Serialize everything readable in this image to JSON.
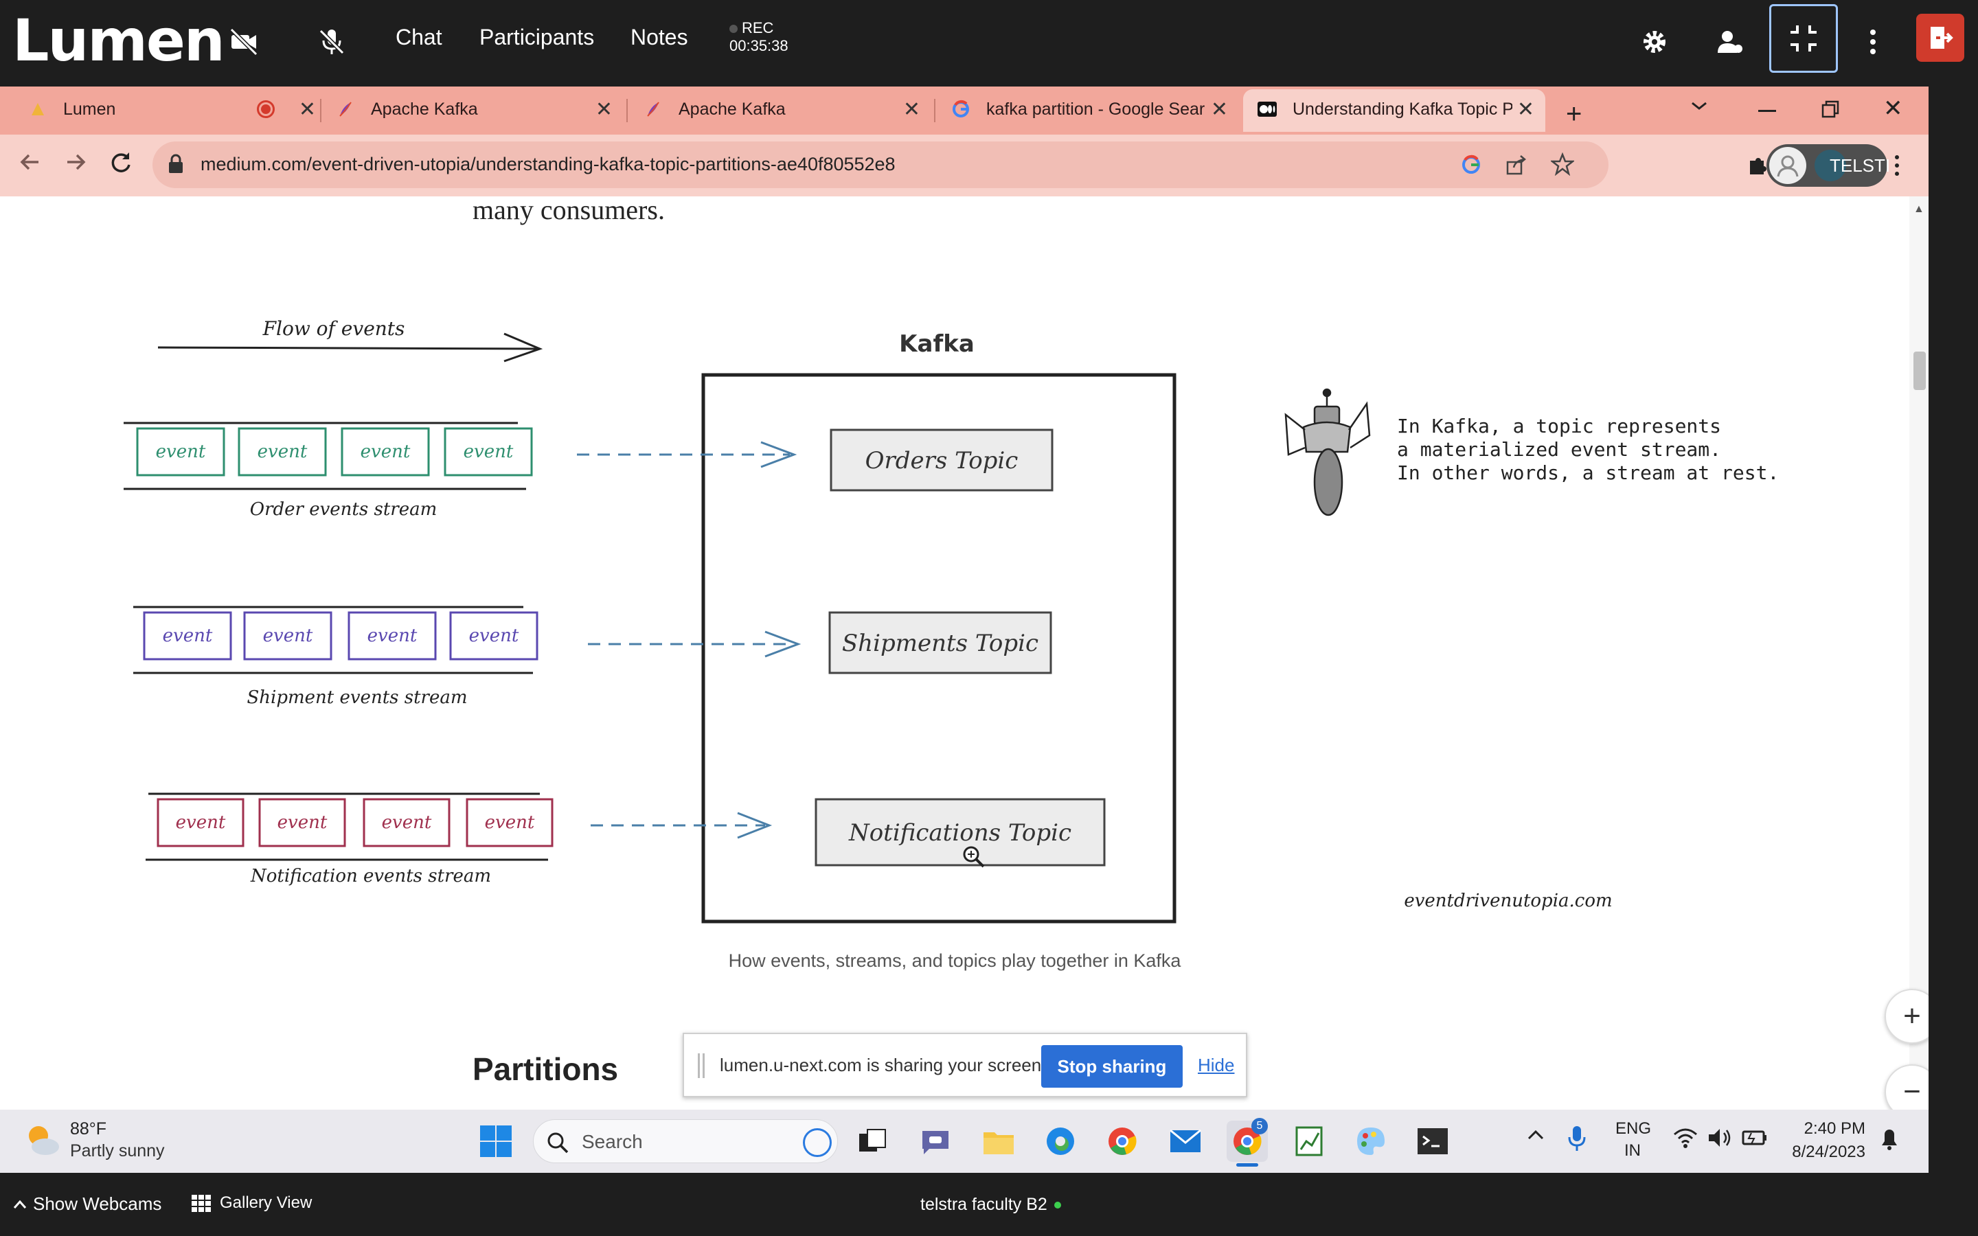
{
  "lumen": {
    "logo": "Lumen",
    "nav": {
      "chat": "Chat",
      "participants": "Participants",
      "notes": "Notes"
    },
    "rec_label": "REC",
    "rec_time": "00:35:38",
    "icons": [
      "video-off-icon",
      "mic-off-icon",
      "gear-icon",
      "person-icon",
      "minimize-icon",
      "more-icon",
      "leave-icon"
    ]
  },
  "browser": {
    "tabs": [
      {
        "title": "Lumen",
        "icon": "lumen-icon"
      },
      {
        "title": "Apache Kafka",
        "icon": "kafka-icon"
      },
      {
        "title": "Apache Kafka",
        "icon": "kafka-icon"
      },
      {
        "title": "kafka partition - Google Sear",
        "icon": "google-icon"
      },
      {
        "title": "Understanding Kafka Topic P",
        "icon": "medium-icon"
      }
    ],
    "url": "medium.com/event-driven-utopia/understanding-kafka-topic-partitions-ae40f80552e8",
    "profile_label": "TELSTI"
  },
  "article": {
    "lead_text": "many consumers.",
    "figure": {
      "flow_label": "Flow of events",
      "kafka_label": "Kafka",
      "event_label": "event",
      "streams": [
        {
          "label": "Order events stream",
          "color": "#2e8f6f"
        },
        {
          "label": "Shipment events stream",
          "color": "#5a48b0"
        },
        {
          "label": "Notification events stream",
          "color": "#a0304e"
        }
      ],
      "topics": [
        "Orders Topic",
        "Shipments Topic",
        "Notifications Topic"
      ],
      "robot_text": [
        "In Kafka, a topic represents",
        "a materialized event stream.",
        "In other words, a stream at rest."
      ],
      "watermark": "eventdrivenutopia.com"
    },
    "caption": "How events, streams, and topics play together in Kafka",
    "section_heading": "Partitions"
  },
  "share_banner": {
    "text": "lumen.u-next.com is sharing your screen.",
    "stop": "Stop sharing",
    "hide": "Hide"
  },
  "taskbar": {
    "weather_temp": "88°F",
    "weather_desc": "Partly sunny",
    "search": "Search",
    "lang_top": "ENG",
    "lang_bottom": "IN",
    "time": "2:40 PM",
    "date": "8/24/2023",
    "chrome_badge": "5"
  },
  "bottom": {
    "show_webcams": "Show Webcams",
    "gallery_view": "Gallery View",
    "room": "telstra faculty B2"
  }
}
